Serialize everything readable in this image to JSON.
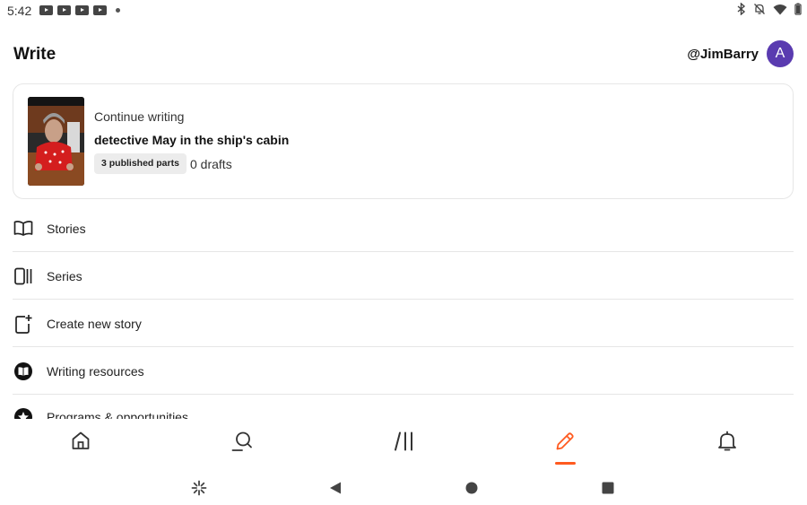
{
  "status_bar": {
    "time": "5:42",
    "left_icons": [
      "youtube-icon",
      "youtube-icon",
      "youtube-icon",
      "youtube-icon",
      "notification-dot-icon"
    ],
    "right_icons": [
      "bluetooth-icon",
      "notifications-off-icon",
      "wifi-icon",
      "battery-icon"
    ]
  },
  "header": {
    "title": "Write",
    "username": "@JimBarry",
    "avatar_letter": "A",
    "avatar_color": "#5a3bb0"
  },
  "continue_card": {
    "kicker": "Continue writing",
    "story_title": "detective May in the ship's cabin",
    "published_badge": "3 published parts",
    "drafts": "0 drafts"
  },
  "menu": {
    "items": [
      {
        "label": "Stories",
        "icon": "open-book-icon"
      },
      {
        "label": "Series",
        "icon": "series-stack-icon"
      },
      {
        "label": "Create new story",
        "icon": "new-page-plus-icon"
      },
      {
        "label": "Writing resources",
        "icon": "book-circle-icon"
      },
      {
        "label": "Programs & opportunities",
        "icon": "star-circle-icon"
      }
    ]
  },
  "bottom_nav": {
    "items": [
      {
        "name": "home",
        "icon": "home-icon"
      },
      {
        "name": "search",
        "icon": "search-icon"
      },
      {
        "name": "library",
        "icon": "library-icon"
      },
      {
        "name": "write",
        "icon": "pencil-icon",
        "active": true
      },
      {
        "name": "notifications",
        "icon": "bell-icon"
      }
    ],
    "active_color": "#ff5a1f"
  },
  "system_nav": {
    "buttons": [
      "assistant-icon",
      "back-icon",
      "home-circle-icon",
      "recents-square-icon"
    ]
  }
}
